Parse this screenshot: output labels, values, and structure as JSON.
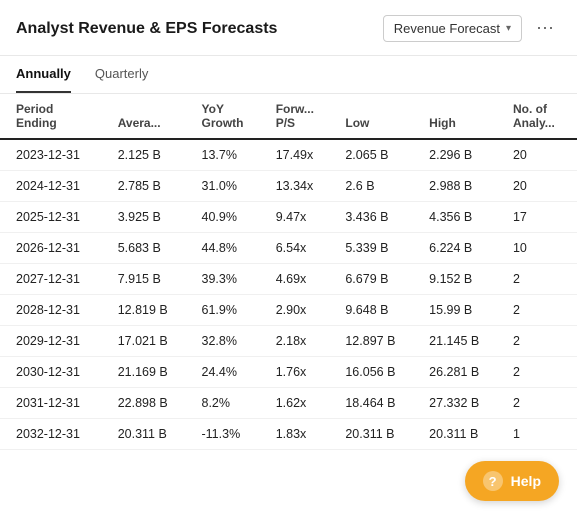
{
  "header": {
    "title": "Analyst Revenue & EPS Forecasts",
    "dropdown_label": "Revenue Forecast",
    "more_icon": "⋯"
  },
  "tabs": [
    {
      "label": "Annually",
      "active": true
    },
    {
      "label": "Quarterly",
      "active": false
    }
  ],
  "table": {
    "columns": [
      {
        "key": "period",
        "label": "Period\nEnding"
      },
      {
        "key": "average",
        "label": "Avera..."
      },
      {
        "key": "yoy",
        "label": "YoY\nGrowth"
      },
      {
        "key": "forwardPS",
        "label": "Forw...\nP/S"
      },
      {
        "key": "low",
        "label": "Low"
      },
      {
        "key": "high",
        "label": "High"
      },
      {
        "key": "analysts",
        "label": "No. of\nAnaly..."
      }
    ],
    "rows": [
      {
        "period": "2023-12-31",
        "average": "2.125 B",
        "yoy": "13.7%",
        "forwardPS": "17.49x",
        "low": "2.065 B",
        "high": "2.296 B",
        "analysts": "20"
      },
      {
        "period": "2024-12-31",
        "average": "2.785 B",
        "yoy": "31.0%",
        "forwardPS": "13.34x",
        "low": "2.6 B",
        "high": "2.988 B",
        "analysts": "20"
      },
      {
        "period": "2025-12-31",
        "average": "3.925 B",
        "yoy": "40.9%",
        "forwardPS": "9.47x",
        "low": "3.436 B",
        "high": "4.356 B",
        "analysts": "17"
      },
      {
        "period": "2026-12-31",
        "average": "5.683 B",
        "yoy": "44.8%",
        "forwardPS": "6.54x",
        "low": "5.339 B",
        "high": "6.224 B",
        "analysts": "10"
      },
      {
        "period": "2027-12-31",
        "average": "7.915 B",
        "yoy": "39.3%",
        "forwardPS": "4.69x",
        "low": "6.679 B",
        "high": "9.152 B",
        "analysts": "2"
      },
      {
        "period": "2028-12-31",
        "average": "12.819 B",
        "yoy": "61.9%",
        "forwardPS": "2.90x",
        "low": "9.648 B",
        "high": "15.99 B",
        "analysts": "2"
      },
      {
        "period": "2029-12-31",
        "average": "17.021 B",
        "yoy": "32.8%",
        "forwardPS": "2.18x",
        "low": "12.897 B",
        "high": "21.145 B",
        "analysts": "2"
      },
      {
        "period": "2030-12-31",
        "average": "21.169 B",
        "yoy": "24.4%",
        "forwardPS": "1.76x",
        "low": "16.056 B",
        "high": "26.281 B",
        "analysts": "2"
      },
      {
        "period": "2031-12-31",
        "average": "22.898 B",
        "yoy": "8.2%",
        "forwardPS": "1.62x",
        "low": "18.464 B",
        "high": "27.332 B",
        "analysts": "2"
      },
      {
        "period": "2032-12-31",
        "average": "20.311 B",
        "yoy": "-11.3%",
        "forwardPS": "1.83x",
        "low": "20.311 B",
        "high": "20.311 B",
        "analysts": "1"
      }
    ]
  },
  "help_button": {
    "label": "Help",
    "icon": "?"
  }
}
